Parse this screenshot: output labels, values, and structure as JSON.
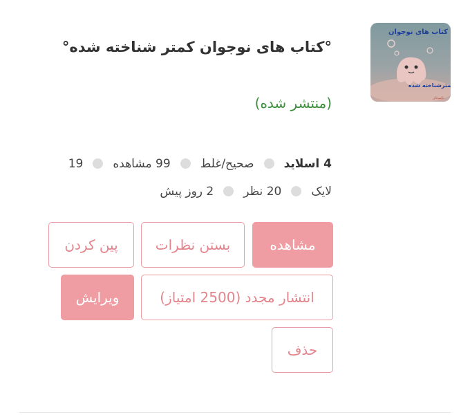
{
  "quiz": {
    "thumbnail": {
      "title_text": "کتاب های نوجوان",
      "subtitle_text": "کمترشناخته شده",
      "brand_text": "تایپ‌دار"
    },
    "title": "°کتاب های نوجوان کمتر شناخته شده°",
    "status": "(منتشر شده)",
    "stats": {
      "slides": "4 اسلاید",
      "type": "صحیح/غلط",
      "views": "99 مشاهده",
      "likes_count": "19",
      "likes_label": "لایک",
      "comments": "20 نظر",
      "time_ago": "2 روز پیش"
    },
    "actions": {
      "view": "مشاهده",
      "close_comments": "بستن نظرات",
      "pin": "پین کردن",
      "republish": "انتشار مجدد (2500 امتیاز)",
      "edit": "ویرایش",
      "delete": "حذف"
    }
  }
}
